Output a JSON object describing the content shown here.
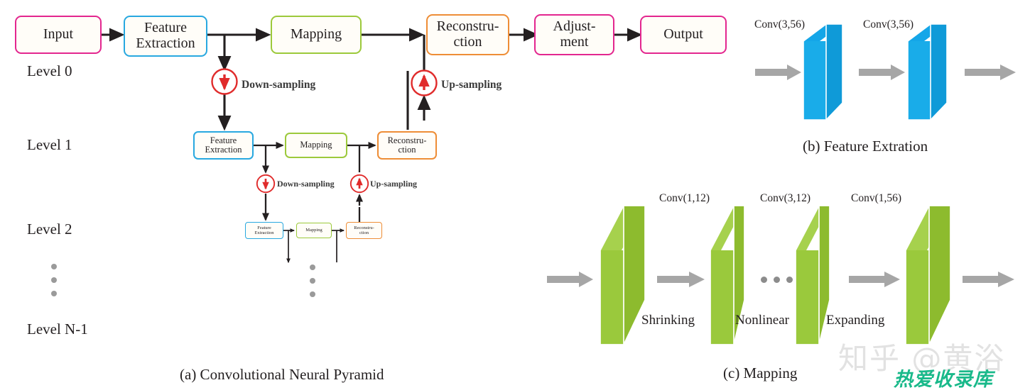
{
  "figure": {
    "panel_a": {
      "caption": "(a) Convolutional Neural Pyramid",
      "levels": [
        {
          "label": "Level 0"
        },
        {
          "label": "Level 1"
        },
        {
          "label": "Level 2"
        },
        {
          "label": "Level N-1"
        }
      ],
      "level0_nodes": [
        {
          "label": "Input",
          "color": "#e3268f"
        },
        {
          "label": "Feature\nExtraction",
          "color": "#28a8e0"
        },
        {
          "label": "Mapping",
          "color": "#9cc93b"
        },
        {
          "label": "Reconstru-\nction",
          "color": "#ee8d36"
        },
        {
          "label": "Adjust-\nment",
          "color": "#e3268f"
        },
        {
          "label": "Output",
          "color": "#e3268f"
        }
      ],
      "level1_nodes": [
        {
          "label": "Feature\nExtraction",
          "color": "#28a8e0"
        },
        {
          "label": "Mapping",
          "color": "#9cc93b"
        },
        {
          "label": "Reconstru-\nction",
          "color": "#ee8d36"
        }
      ],
      "level2_nodes": [
        {
          "label": "Feature\nExtraction",
          "color": "#28a8e0"
        },
        {
          "label": "Mapping",
          "color": "#9cc93b"
        },
        {
          "label": "Reconstru-\nction",
          "color": "#ee8d36"
        }
      ],
      "sampling_labels": {
        "down_0": "Down-sampling",
        "up_0": "Up-sampling",
        "down_1": "Down-sampling",
        "up_1": "Up-sampling"
      },
      "arrow_color": "#231f20",
      "sampling_circle_color": "#e02b2b"
    },
    "panel_b": {
      "caption": "(b) Feature Extration",
      "block_color": "#14a6e8",
      "blocks": [
        {
          "conv_label": "Conv(3,56)"
        },
        {
          "conv_label": "Conv(3,56)"
        }
      ],
      "arrow_color": "#a6a6a6"
    },
    "panel_c": {
      "caption": "(c) Mapping",
      "block_color": "#9ac93c",
      "conv_labels": [
        "Conv(1,12)",
        "Conv(3,12)",
        "Conv(1,56)"
      ],
      "stage_labels": [
        "Shrinking",
        "Nonlinear",
        "Expanding"
      ],
      "arrow_color": "#a6a6a6"
    },
    "watermark": {
      "line1": "知乎 @黄浴",
      "line2": "热爱收录库"
    }
  }
}
